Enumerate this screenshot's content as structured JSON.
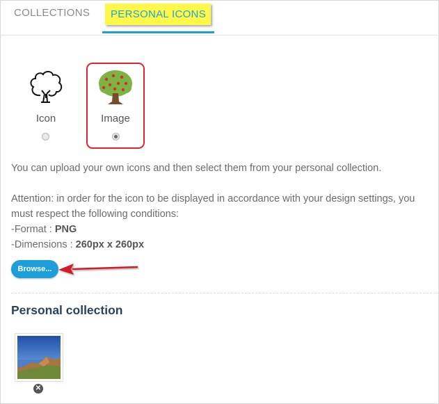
{
  "tabs": {
    "collections": "COLLECTIONS",
    "personal_icons": "PERSONAL ICONS"
  },
  "options": {
    "icon_label": "Icon",
    "image_label": "Image",
    "selected": "Image"
  },
  "info": {
    "line1": "You can upload your own icons and then select them from your personal collection.",
    "attention_line1": "Attention: in order for the icon to be displayed in accordance with your design settings, you",
    "attention_line2": "must respect the following conditions:",
    "format_label": "-Format : ",
    "format_value": "PNG",
    "dimensions_label": "-Dimensions : ",
    "dimensions_value": "260px x 260px"
  },
  "browse_button": "Browse...",
  "personal_collection": {
    "title": "Personal collection"
  },
  "colors": {
    "accent": "#1a9fcf",
    "highlight": "#fff84a",
    "annotation_red": "#e0232f",
    "title": "#28445a"
  }
}
